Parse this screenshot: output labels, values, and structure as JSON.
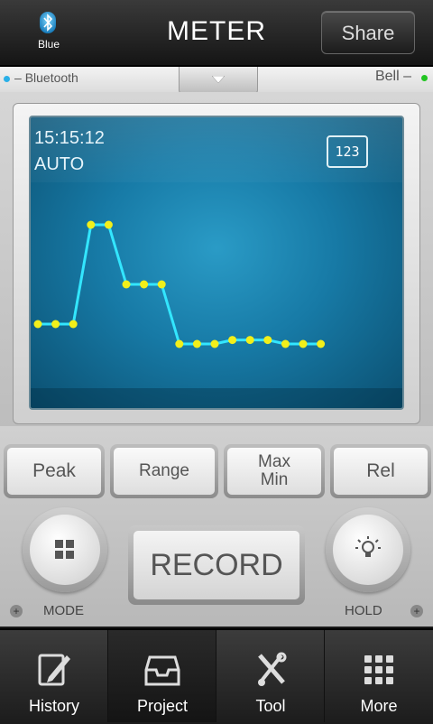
{
  "header": {
    "bluetooth_label": "Blue",
    "title": "METER",
    "share_label": "Share"
  },
  "status": {
    "left": "Bluetooth",
    "right": "Bell"
  },
  "display": {
    "time": "15:15:12",
    "mode": "AUTO",
    "digits_badge": "123"
  },
  "chart_data": {
    "type": "line",
    "x": [
      1,
      2,
      3,
      4,
      5,
      6,
      7,
      8,
      9,
      10,
      11,
      12,
      13,
      14,
      15,
      16,
      17
    ],
    "values": [
      5.5,
      5.5,
      5.5,
      8.0,
      8.0,
      6.5,
      6.5,
      6.5,
      5.0,
      5.0,
      5.0,
      5.1,
      5.1,
      5.1,
      5.0,
      5.0,
      5.0
    ],
    "color_line": "#33e6ff",
    "color_point": "#f2ef1a"
  },
  "buttons": {
    "peak": "Peak",
    "range": "Range",
    "maxmin_line1": "Max",
    "maxmin_line2": "Min",
    "rel": "Rel",
    "record": "RECORD",
    "mode_label": "MODE",
    "hold_label": "HOLD"
  },
  "nav": [
    {
      "label": "History",
      "icon": "edit-icon"
    },
    {
      "label": "Project",
      "icon": "inbox-icon"
    },
    {
      "label": "Tool",
      "icon": "tools-icon"
    },
    {
      "label": "More",
      "icon": "grid-icon"
    }
  ],
  "colors": {
    "accent": "#1a86b3",
    "status_led": "#22c522",
    "bt_led": "#2ab0e8"
  }
}
